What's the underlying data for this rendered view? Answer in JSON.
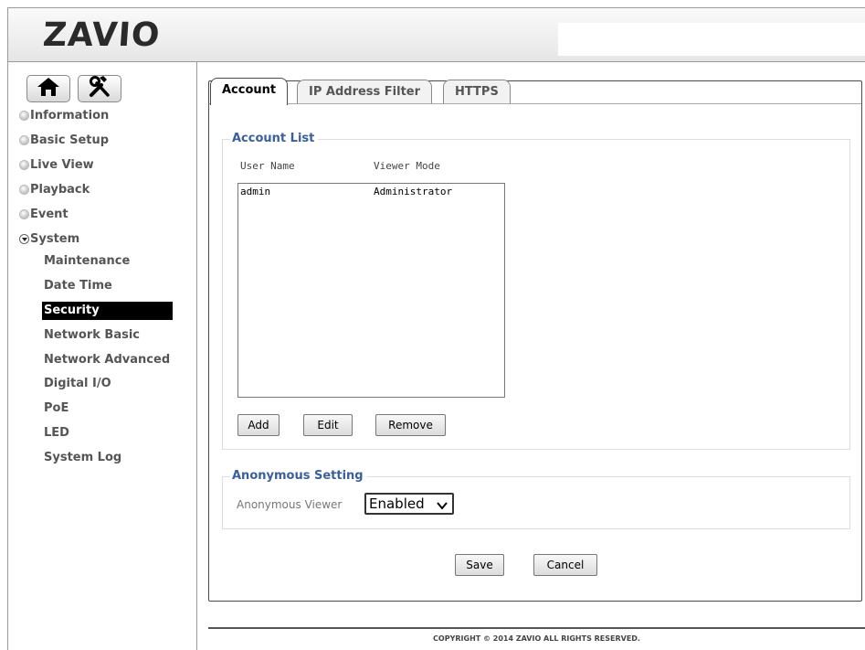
{
  "header": {
    "logo_text": "ZAVIO"
  },
  "sidebar": {
    "home_icon": "home-icon",
    "tools_icon": "tools-icon",
    "menu": [
      {
        "label": "Information"
      },
      {
        "label": "Basic Setup"
      },
      {
        "label": "Live View"
      },
      {
        "label": "Playback"
      },
      {
        "label": "Event"
      },
      {
        "label": "System"
      }
    ],
    "system_items": [
      {
        "label": "Maintenance"
      },
      {
        "label": "Date Time"
      },
      {
        "label": "Security",
        "active": true
      },
      {
        "label": "Network Basic"
      },
      {
        "label": "Network Advanced"
      },
      {
        "label": "Digital I/O"
      },
      {
        "label": "PoE"
      },
      {
        "label": "LED"
      },
      {
        "label": "System Log"
      }
    ]
  },
  "tabs": [
    {
      "label": "Account",
      "active": true
    },
    {
      "label": "IP Address Filter"
    },
    {
      "label": "HTTPS"
    }
  ],
  "account_list": {
    "legend": "Account List",
    "col_user": "User Name",
    "col_mode": "Viewer Mode",
    "rows": [
      {
        "user": "admin",
        "mode": "Administrator"
      }
    ],
    "add_label": "Add",
    "edit_label": "Edit",
    "remove_label": "Remove"
  },
  "anonymous": {
    "legend": "Anonymous Setting",
    "viewer_label": "Anonymous Viewer",
    "viewer_value": "Enabled"
  },
  "actions": {
    "save_label": "Save",
    "cancel_label": "Cancel"
  },
  "footer": {
    "copyright": "COPYRIGHT © 2014 ZAVIO ALL RIGHTS RESERVED."
  },
  "colors": {
    "legend": "#3a5f9a",
    "active_item_bg": "#000000"
  }
}
